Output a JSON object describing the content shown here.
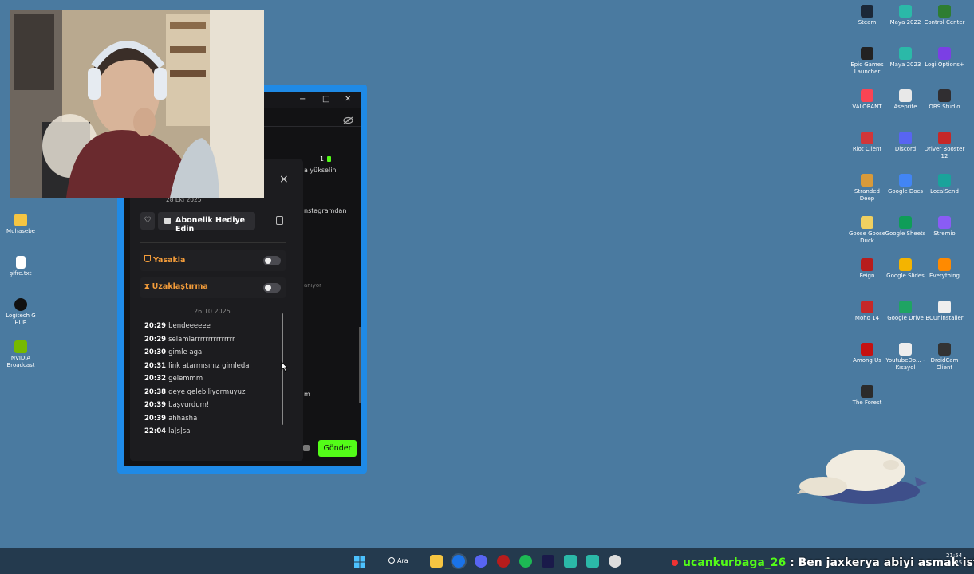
{
  "desktop_left": [
    {
      "label": "Muhasebe",
      "color": "#f5c542"
    },
    {
      "label": "şifre.txt",
      "color": "#ffffff"
    },
    {
      "label": "Logitech G HUB",
      "color": "#111111"
    },
    {
      "label": "NVIDIA Broadcast",
      "color": "#76b900"
    }
  ],
  "desktop_right": [
    {
      "label": "Steam",
      "color": "#1b2838"
    },
    {
      "label": "Maya 2022",
      "color": "#2bb9a8"
    },
    {
      "label": "Control Center",
      "color": "#2e7d32"
    },
    {
      "label": "Epic Games Launcher",
      "color": "#222222"
    },
    {
      "label": "Maya 2023",
      "color": "#2bb9a8"
    },
    {
      "label": "Logi Options+",
      "color": "#7b3fe4"
    },
    {
      "label": "VALORANT",
      "color": "#fa4454"
    },
    {
      "label": "Aseprite",
      "color": "#e8e8e8"
    },
    {
      "label": "OBS Studio",
      "color": "#302e31"
    },
    {
      "label": "Riot Client",
      "color": "#d13639"
    },
    {
      "label": "Discord",
      "color": "#5865f2"
    },
    {
      "label": "Driver Booster 12",
      "color": "#c62828"
    },
    {
      "label": "Stranded Deep",
      "color": "#d89a3a"
    },
    {
      "label": "Google Docs",
      "color": "#4285f4"
    },
    {
      "label": "LocalSend",
      "color": "#1aa39b"
    },
    {
      "label": "Goose Goose Duck",
      "color": "#f0d060"
    },
    {
      "label": "Google Sheets",
      "color": "#0f9d58"
    },
    {
      "label": "Stremio",
      "color": "#8a5cf5"
    },
    {
      "label": "Feign",
      "color": "#b71c1c"
    },
    {
      "label": "Google Slides",
      "color": "#f4b400"
    },
    {
      "label": "Everything",
      "color": "#ff8a00"
    },
    {
      "label": "Moho 14",
      "color": "#c62828"
    },
    {
      "label": "Google Drive",
      "color": "#1fa463"
    },
    {
      "label": "BCUninstaller",
      "color": "#eeeeee"
    },
    {
      "label": "Among Us",
      "color": "#c51111"
    },
    {
      "label": "YoutubeDo... - Kısayol",
      "color": "#eeeeee"
    },
    {
      "label": "DroidCam Client",
      "color": "#333333"
    },
    {
      "label": "The Forest",
      "color": "#2b2b2b"
    }
  ],
  "window": {
    "minimize": "−",
    "maximize": "□",
    "close": "✕",
    "eye_icon": "eye-off-icon",
    "background_frag_1": "a yükselin",
    "background_frag_count": "1",
    "background_frag_2": "nstagramdan",
    "background_frag_3": "anıyor",
    "background_frag_4": "m",
    "send_label": "Gönder"
  },
  "modal": {
    "close": "×",
    "joined_date": "28 Eki 2025",
    "heart_icon": "♡",
    "gift_label": "Abonelik Hediye Edin",
    "ban_label": "Yasakla",
    "timeout_label": "Uzaklaştırma",
    "date_header": "26.10.2025",
    "messages": [
      {
        "time": "20:29",
        "text": "bendeeeeee"
      },
      {
        "time": "20:29",
        "text": "selamlarrrrrrrrrrrrrrr"
      },
      {
        "time": "20:30",
        "text": "gimle aga"
      },
      {
        "time": "20:31",
        "text": "link atarmısınız gimleda"
      },
      {
        "time": "20:32",
        "text": "gelemmm"
      },
      {
        "time": "20:38",
        "text": "deye gelebiliyormuyuz"
      },
      {
        "time": "20:39",
        "text": "başvurdum!"
      },
      {
        "time": "20:39",
        "text": "ahhasha"
      },
      {
        "time": "22:04",
        "text": "la|s|sa"
      }
    ]
  },
  "taskbar": {
    "search_label": "Ara",
    "chat_user": "ucankurbaga_26",
    "chat_sep": " : ",
    "chat_message": "Ben jaxkerya abiyi asmak istiyorum",
    "clock_time": "21:54",
    "clock_date": "25"
  }
}
